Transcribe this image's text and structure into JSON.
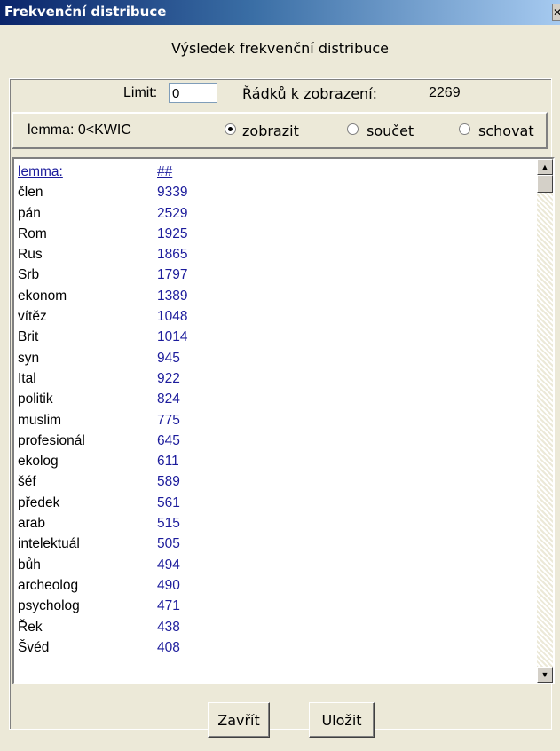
{
  "window": {
    "title": "Frekvenční distribuce",
    "close_symbol": "✕",
    "heading": "Výsledek frekvenční distribuce"
  },
  "limit": {
    "label": "Limit:",
    "value": "0",
    "rows_label": "Řádků k zobrazení:",
    "rows_value": "2269"
  },
  "options": {
    "label": "lemma: 0<KWIC",
    "radios": [
      {
        "label": "zobrazit",
        "checked": true
      },
      {
        "label": "součet",
        "checked": false
      },
      {
        "label": "schovat",
        "checked": false
      }
    ]
  },
  "table": {
    "headers": [
      "lemma:",
      "##"
    ],
    "rows": [
      [
        "člen",
        "9339"
      ],
      [
        "pán",
        "2529"
      ],
      [
        "Rom",
        "1925"
      ],
      [
        "Rus",
        "1865"
      ],
      [
        "Srb",
        "1797"
      ],
      [
        "ekonom",
        "1389"
      ],
      [
        "vítěz",
        "1048"
      ],
      [
        "Brit",
        "1014"
      ],
      [
        "syn",
        "945"
      ],
      [
        "Ital",
        "922"
      ],
      [
        "politik",
        "824"
      ],
      [
        "muslim",
        "775"
      ],
      [
        "profesionál",
        "645"
      ],
      [
        "ekolog",
        "611"
      ],
      [
        "šéf",
        "589"
      ],
      [
        "předek",
        "561"
      ],
      [
        "arab",
        "515"
      ],
      [
        "intelektuál",
        "505"
      ],
      [
        "bůh",
        "494"
      ],
      [
        "archeolog",
        "490"
      ],
      [
        "psycholog",
        "471"
      ],
      [
        "Řek",
        "438"
      ],
      [
        "Švéd",
        "408"
      ]
    ]
  },
  "buttons": {
    "close": "Zavřít",
    "save": "Uložit"
  },
  "icons": {
    "scroll_up": "scroll-up-arrow-icon",
    "scroll_down": "scroll-down-arrow-icon"
  }
}
